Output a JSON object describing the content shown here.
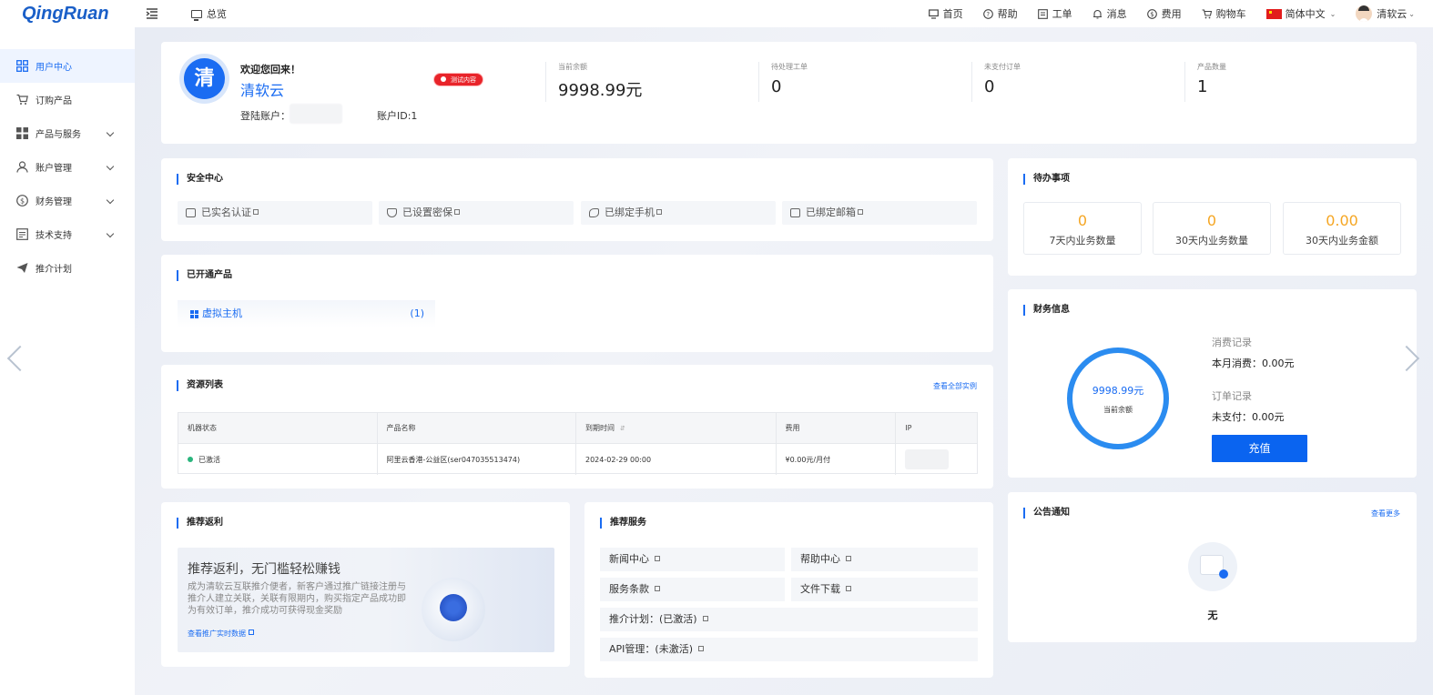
{
  "header": {
    "logo": "QingRuan",
    "overview": "总览",
    "nav": [
      "首页",
      "帮助",
      "工单",
      "消息",
      "费用",
      "购物车"
    ],
    "language": "简体中文",
    "user": "清软云"
  },
  "sidebar": {
    "items": [
      {
        "label": "用户中心"
      },
      {
        "label": "订购产品"
      },
      {
        "label": "产品与服务"
      },
      {
        "label": "账户管理"
      },
      {
        "label": "财务管理"
      },
      {
        "label": "技术支持"
      },
      {
        "label": "推介计划"
      }
    ]
  },
  "welcome": {
    "avatar_char": "清",
    "greeting": "欢迎您回来！",
    "name": "清软云",
    "badge": "测试内容",
    "login_label": "登陆账户：",
    "account_id": "账户ID:1",
    "stats": [
      {
        "label": "当前余额",
        "value": "9998.99元"
      },
      {
        "label": "待处理工单",
        "value": "0"
      },
      {
        "label": "未支付订单",
        "value": "0"
      },
      {
        "label": "产品数量",
        "value": "1"
      }
    ]
  },
  "security": {
    "title": "安全中心",
    "items": [
      "已实名认证",
      "已设置密保",
      "已绑定手机",
      "已绑定邮箱"
    ]
  },
  "products": {
    "title": "已开通产品",
    "items": [
      {
        "name": "虚拟主机",
        "count": "(1)"
      }
    ]
  },
  "resources": {
    "title": "资源列表",
    "link": "查看全部实例",
    "columns": [
      "机器状态",
      "产品名称",
      "到期时间",
      "费用",
      "IP"
    ],
    "rows": [
      {
        "status": "已激活",
        "product": "阿里云香港-公益区(ser047035513474)",
        "expire": "2024-02-29 00:00",
        "fee": "¥0.00元/月付",
        "ip": ""
      }
    ]
  },
  "referral": {
    "title": "推荐返利",
    "headline": "推荐返利，无门槛轻松赚钱",
    "desc": "成为清软云互联推介便者，新客户通过推广链接注册与推介人建立关联，关联有限期内，购买指定产品成功即为有效订单，推介成功可获得现金奖励",
    "link": "查看推广实时数据"
  },
  "services": {
    "title": "推荐服务",
    "items": [
      "新闻中心",
      "帮助中心",
      "服务条款",
      "文件下载",
      "推介计划：(已激活)",
      "API管理：(未激活)"
    ]
  },
  "todo": {
    "title": "待办事项",
    "items": [
      {
        "value": "0",
        "label": "7天内业务数量"
      },
      {
        "value": "0",
        "label": "30天内业务数量"
      },
      {
        "value": "0.00",
        "label": "30天内业务金额"
      }
    ]
  },
  "finance": {
    "title": "财务信息",
    "balance": "9998.99元",
    "balance_label": "当前余额",
    "consume_label": "消费记录",
    "consume_value": "本月消费：0.00元",
    "order_label": "订单记录",
    "order_value": "未支付：0.00元",
    "recharge": "充值"
  },
  "notice": {
    "title": "公告通知",
    "link": "查看更多",
    "empty": "无"
  },
  "colors": {
    "primary": "#1a6cf2",
    "accent": "#f5a623",
    "badge": "#e8242a",
    "status_active": "#2ab57d"
  }
}
